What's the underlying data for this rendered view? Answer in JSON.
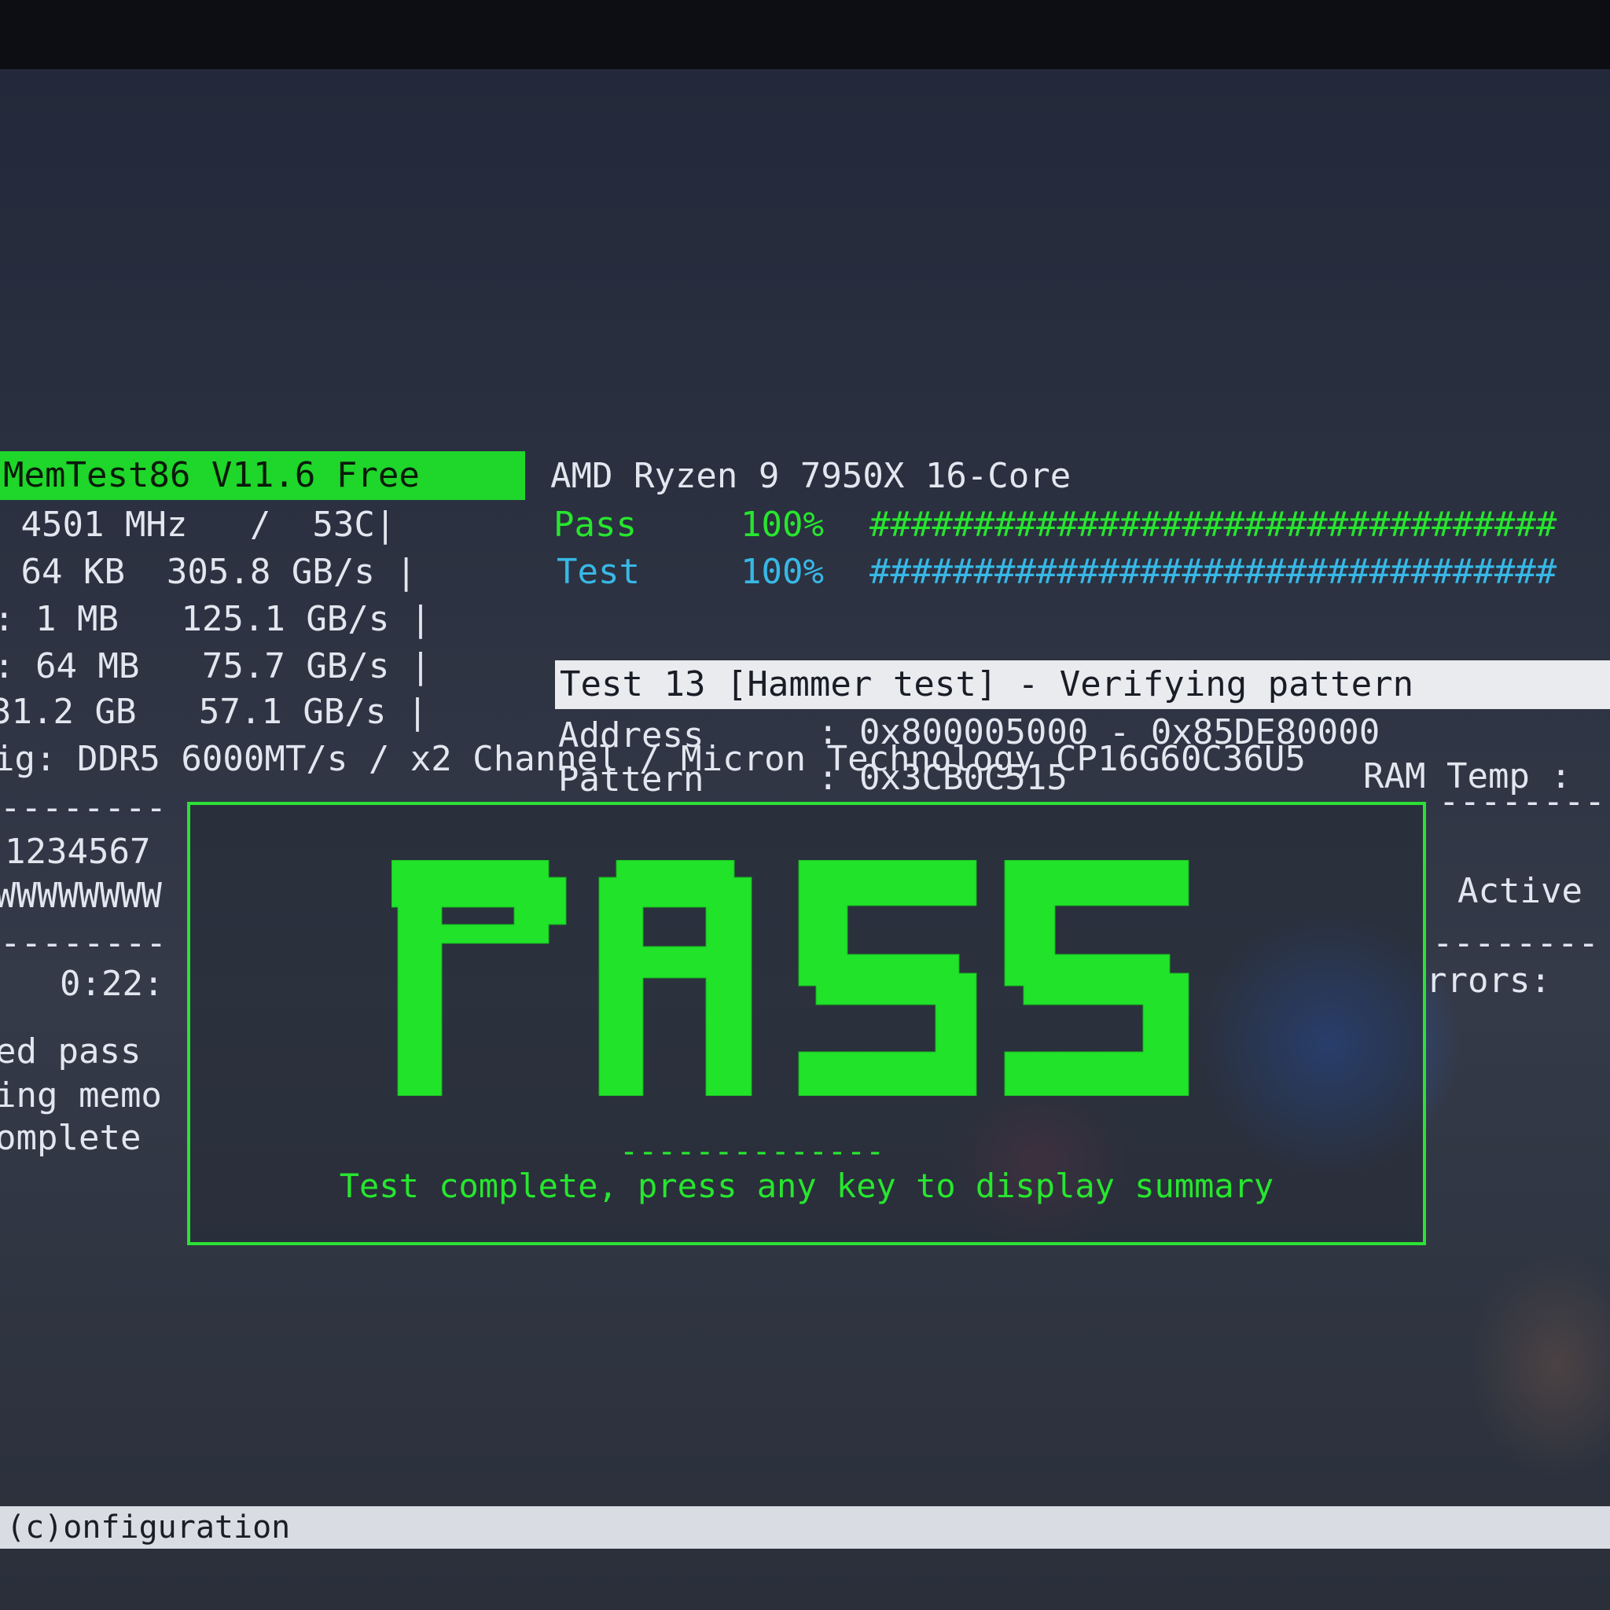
{
  "header": {
    "app_title": "MemTest86 V11.6 Free",
    "cpu_name": "AMD Ryzen 9 7950X 16-Core"
  },
  "left_stats": {
    "cpu_line": " 4501 MHz   /  53C|",
    "l1_line": " 64 KB  305.8 GB/s |",
    "l2_line": ": 1 MB   125.1 GB/s |",
    "l3_line": ": 64 MB   75.7 GB/s |",
    "mem_line": "31.2 GB   57.1 GB/s |",
    "config_line": "ig: DDR5 6000MT/s / x2 Channel / Micron Technology CP16G60C36U5"
  },
  "progress": {
    "pass_label": "Pass",
    "pass_percent": "100%",
    "pass_value": 1.0,
    "pass_bar": "#################################",
    "test_label": "Test",
    "test_percent": "100%",
    "test_value": 1.0,
    "test_bar": "#################################"
  },
  "current_test": {
    "title": "Test 13 [Hammer test] - Verifying pattern",
    "address_label": "Address",
    "address_value": ": 0x800005000 - 0x85DE80000",
    "pattern_label": "Pattern",
    "pattern_value": ": 0x3CB0C515",
    "ram_temp_label": "RAM Temp :"
  },
  "left_panel": {
    "dash_top": "--------",
    "cores": "1234567",
    "core_states": "WWWWWWWW",
    "dash_mid": "--------",
    "elapsed": "0:22:",
    "log1": "ed pass",
    "log2": "ing memo",
    "log3": "omplete"
  },
  "right_panel": {
    "dash_top": "--------",
    "active_label": "Active",
    "dash_mid": "--------",
    "errors_label": "rrors:"
  },
  "result": {
    "status_word": "PASS",
    "divider": "--------------",
    "message": "Test complete, press any key to display summary"
  },
  "footer": {
    "hint": "(c)onfiguration"
  },
  "colors": {
    "accent_green": "#27e62e",
    "cyan": "#38b8e6",
    "text": "#e2e6ef"
  }
}
